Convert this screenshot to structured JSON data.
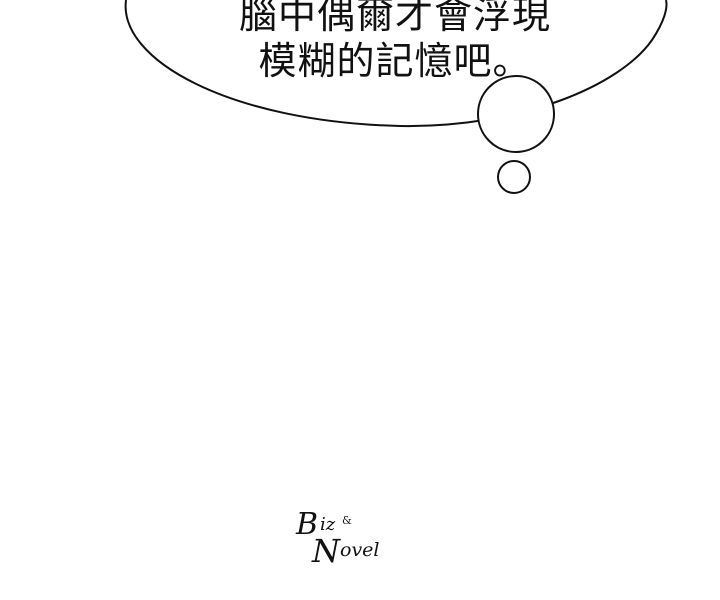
{
  "speech_bubble": {
    "line1": "腦中偶爾才會浮現",
    "line2": "模糊的記憶吧。"
  },
  "watermark": {
    "text": "Biz & Novel"
  },
  "colors": {
    "background": "#ffffff",
    "ink": "#111111"
  }
}
